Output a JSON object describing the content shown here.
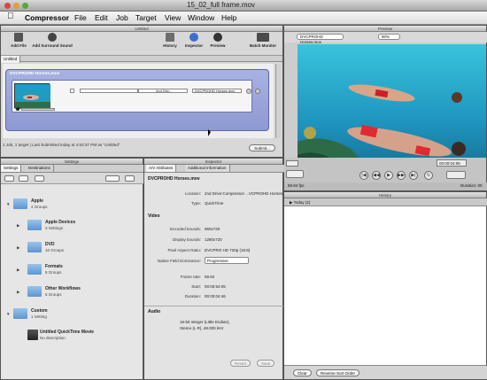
{
  "window": {
    "title": "15_02_full frame.mov"
  },
  "menubar": {
    "apple": "",
    "app": "Compressor",
    "items": [
      "File",
      "Edit",
      "Job",
      "Target",
      "View",
      "Window",
      "Help"
    ]
  },
  "batch": {
    "title": "Untitled",
    "toolbar": {
      "add_file": "Add File",
      "add_surround": "Add Surround Sound",
      "history": "History",
      "inspector": "Inspector",
      "preview": "Preview",
      "batch_monitor": "Batch Monitor"
    },
    "tab": "Untitled",
    "job_name": "DVCPROHD Horses.mov",
    "target_dest": "2nd Driv...",
    "target_setting": "DVCPROHD Horses.mov",
    "status": "1 Job, 1 target  |  Last Submitted today at 4:53:37 PM as \"Untitled\"",
    "submit": "Submit..."
  },
  "preview": {
    "title": "Preview",
    "source": "DVCPROHD Horses.mov",
    "zoom": "90%",
    "timecode_in": "05",
    "timecode_out": "00:00:04:06",
    "size": "59.94 fps",
    "duration_label": "Duration: 00"
  },
  "settings": {
    "title": "Settings",
    "tabs": [
      "Settings",
      "Destinations"
    ],
    "groups": [
      {
        "name": "Apple",
        "sub": "4 Groups"
      },
      {
        "name": "Apple Devices",
        "sub": "3 Settings"
      },
      {
        "name": "DVD",
        "sub": "10 Groups"
      },
      {
        "name": "Formats",
        "sub": "5 Groups"
      },
      {
        "name": "Other Workflows",
        "sub": "5 Groups"
      },
      {
        "name": "Custom",
        "sub": "1 Setting"
      },
      {
        "name": "Untitled QuickTime Movie",
        "sub": "No description"
      }
    ]
  },
  "inspector": {
    "title": "Inspector",
    "tabs": [
      "A/V Attributes",
      "Additional Information"
    ],
    "file": "DVCPROHD Horses.mov",
    "location_label": "Location:",
    "location": "2nd Drive:Compressor ...VCPROHD Horses.mov",
    "type_label": "Type:",
    "type": "QuickTime",
    "video_head": "Video",
    "rows": [
      {
        "label": "Encoded bounds:",
        "value": "960x720"
      },
      {
        "label": "Display bounds:",
        "value": "1280x720"
      },
      {
        "label": "Pixel Aspect Ratio:",
        "value": "DVCPRO HD 720p (16:9)"
      }
    ],
    "field_label": "Native Field Dominance:",
    "field_value": "Progressive",
    "rows2": [
      {
        "label": "Frame rate:",
        "value": "59.94"
      },
      {
        "label": "Start:",
        "value": "00:00:54:05"
      },
      {
        "label": "Duration:",
        "value": "00:00:04:46"
      }
    ],
    "audio_head": "Audio",
    "audio_desc1": "16-bit Integer (Little Endian),",
    "audio_desc2": "Stereo (L R), 48.000 kHz",
    "revert": "Revert",
    "save": "Save"
  },
  "history": {
    "title": "History",
    "today": "Today (2)",
    "clear": "Clear",
    "reverse": "Reverse Sort Order"
  }
}
